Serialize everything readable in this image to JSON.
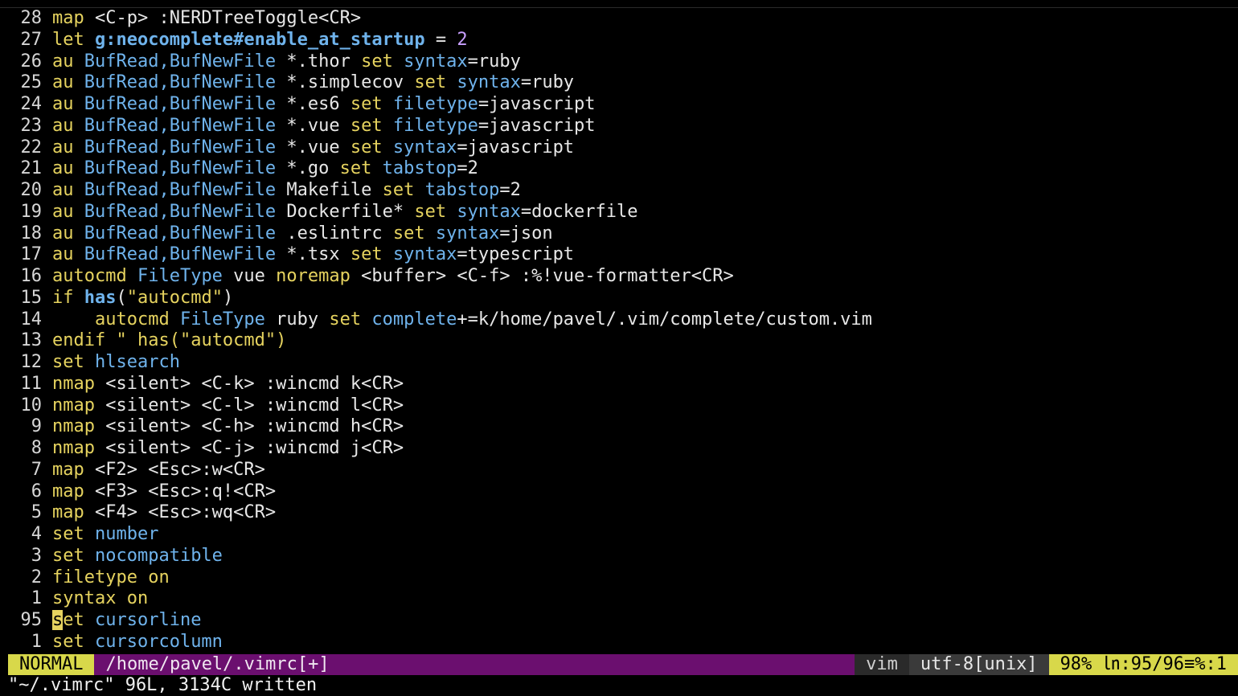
{
  "editor": {
    "lines": [
      {
        "num": "28",
        "segs": [
          [
            "map ",
            "k"
          ],
          [
            "<C-p> :NERDTreeToggle<CR>",
            "t"
          ]
        ]
      },
      {
        "num": "27",
        "segs": [
          [
            "let ",
            "k"
          ],
          [
            "g:neocomplete#enable_at_startup",
            "ob"
          ],
          [
            " = ",
            "t"
          ],
          [
            "2",
            "n"
          ]
        ]
      },
      {
        "num": "26",
        "segs": [
          [
            "au ",
            "k"
          ],
          [
            "BufRead,BufNewFile",
            "o"
          ],
          [
            " *.thor ",
            "t"
          ],
          [
            "set ",
            "k"
          ],
          [
            "syntax",
            "o"
          ],
          [
            "=ruby",
            "t"
          ]
        ]
      },
      {
        "num": "25",
        "segs": [
          [
            "au ",
            "k"
          ],
          [
            "BufRead,BufNewFile",
            "o"
          ],
          [
            " *.simplecov ",
            "t"
          ],
          [
            "set ",
            "k"
          ],
          [
            "syntax",
            "o"
          ],
          [
            "=ruby",
            "t"
          ]
        ]
      },
      {
        "num": "24",
        "segs": [
          [
            "au ",
            "k"
          ],
          [
            "BufRead,BufNewFile",
            "o"
          ],
          [
            " *.es6 ",
            "t"
          ],
          [
            "set ",
            "k"
          ],
          [
            "filetype",
            "o"
          ],
          [
            "=javascript",
            "t"
          ]
        ]
      },
      {
        "num": "23",
        "segs": [
          [
            "au ",
            "k"
          ],
          [
            "BufRead,BufNewFile",
            "o"
          ],
          [
            " *.vue ",
            "t"
          ],
          [
            "set ",
            "k"
          ],
          [
            "filetype",
            "o"
          ],
          [
            "=javascript",
            "t"
          ]
        ]
      },
      {
        "num": "22",
        "segs": [
          [
            "au ",
            "k"
          ],
          [
            "BufRead,BufNewFile",
            "o"
          ],
          [
            " *.vue ",
            "t"
          ],
          [
            "set ",
            "k"
          ],
          [
            "syntax",
            "o"
          ],
          [
            "=javascript",
            "t"
          ]
        ]
      },
      {
        "num": "21",
        "segs": [
          [
            "au ",
            "k"
          ],
          [
            "BufRead,BufNewFile",
            "o"
          ],
          [
            " *.go ",
            "t"
          ],
          [
            "set ",
            "k"
          ],
          [
            "tabstop",
            "o"
          ],
          [
            "=2",
            "t"
          ]
        ]
      },
      {
        "num": "20",
        "segs": [
          [
            "au ",
            "k"
          ],
          [
            "BufRead,BufNewFile",
            "o"
          ],
          [
            " Makefile ",
            "t"
          ],
          [
            "set ",
            "k"
          ],
          [
            "tabstop",
            "o"
          ],
          [
            "=2",
            "t"
          ]
        ]
      },
      {
        "num": "19",
        "segs": [
          [
            "au ",
            "k"
          ],
          [
            "BufRead,BufNewFile",
            "o"
          ],
          [
            " Dockerfile* ",
            "t"
          ],
          [
            "set ",
            "k"
          ],
          [
            "syntax",
            "o"
          ],
          [
            "=dockerfile",
            "t"
          ]
        ]
      },
      {
        "num": "18",
        "segs": [
          [
            "au ",
            "k"
          ],
          [
            "BufRead,BufNewFile",
            "o"
          ],
          [
            " .eslintrc ",
            "t"
          ],
          [
            "set ",
            "k"
          ],
          [
            "syntax",
            "o"
          ],
          [
            "=json",
            "t"
          ]
        ]
      },
      {
        "num": "17",
        "segs": [
          [
            "au ",
            "k"
          ],
          [
            "BufRead,BufNewFile",
            "o"
          ],
          [
            " *.tsx ",
            "t"
          ],
          [
            "set ",
            "k"
          ],
          [
            "syntax",
            "o"
          ],
          [
            "=typescript",
            "t"
          ]
        ]
      },
      {
        "num": "16",
        "segs": [
          [
            "autocmd ",
            "k"
          ],
          [
            "FileType",
            "o"
          ],
          [
            " vue ",
            "t"
          ],
          [
            "noremap ",
            "k"
          ],
          [
            "<buffer> <C-f> :%!vue-formatter<CR>",
            "t"
          ]
        ]
      },
      {
        "num": "15",
        "segs": [
          [
            "if ",
            "k"
          ],
          [
            "has",
            "ob"
          ],
          [
            "(",
            "t"
          ],
          [
            "\"autocmd\"",
            "s"
          ],
          [
            ")",
            "t"
          ]
        ]
      },
      {
        "num": "14",
        "segs": [
          [
            "    autocmd ",
            "k"
          ],
          [
            "FileType",
            "o"
          ],
          [
            " ruby ",
            "t"
          ],
          [
            "set ",
            "k"
          ],
          [
            "complete",
            "o"
          ],
          [
            "+=k/home/pavel/.vim/complete/custom.vim",
            "t"
          ]
        ]
      },
      {
        "num": "13",
        "segs": [
          [
            "endif ",
            "k"
          ],
          [
            "\" has(\"autocmd\")",
            "s"
          ]
        ]
      },
      {
        "num": "12",
        "segs": [
          [
            "set ",
            "k"
          ],
          [
            "hlsearch",
            "o"
          ]
        ]
      },
      {
        "num": "11",
        "segs": [
          [
            "nmap ",
            "k"
          ],
          [
            "<silent> <C-k> :wincmd k<CR>",
            "t"
          ]
        ]
      },
      {
        "num": "10",
        "segs": [
          [
            "nmap ",
            "k"
          ],
          [
            "<silent> <C-l> :wincmd l<CR>",
            "t"
          ]
        ]
      },
      {
        "num": "9",
        "segs": [
          [
            "nmap ",
            "k"
          ],
          [
            "<silent> <C-h> :wincmd h<CR>",
            "t"
          ]
        ]
      },
      {
        "num": "8",
        "segs": [
          [
            "nmap ",
            "k"
          ],
          [
            "<silent> <C-j> :wincmd j<CR>",
            "t"
          ]
        ]
      },
      {
        "num": "7",
        "segs": [
          [
            "map ",
            "k"
          ],
          [
            "<F2> <Esc>:w<CR>",
            "t"
          ]
        ]
      },
      {
        "num": "6",
        "segs": [
          [
            "map ",
            "k"
          ],
          [
            "<F3> <Esc>:q!<CR>",
            "t"
          ]
        ]
      },
      {
        "num": "5",
        "segs": [
          [
            "map ",
            "k"
          ],
          [
            "<F4> <Esc>:wq<CR>",
            "t"
          ]
        ]
      },
      {
        "num": "4",
        "segs": [
          [
            "set ",
            "k"
          ],
          [
            "number",
            "o"
          ]
        ]
      },
      {
        "num": "3",
        "segs": [
          [
            "set ",
            "k"
          ],
          [
            "nocompatible",
            "o"
          ]
        ]
      },
      {
        "num": "2",
        "segs": [
          [
            "filetype ",
            "k"
          ],
          [
            "on",
            "k"
          ]
        ]
      },
      {
        "num": "1",
        "segs": [
          [
            "syntax ",
            "k"
          ],
          [
            "on",
            "k"
          ]
        ]
      },
      {
        "num": "95",
        "segs": [
          [
            "s",
            "cursor"
          ],
          [
            "et ",
            "k"
          ],
          [
            "cursorline",
            "o"
          ]
        ],
        "current": true
      },
      {
        "num": "1",
        "segs": [
          [
            "set ",
            "k"
          ],
          [
            "cursorcolumn",
            "o"
          ]
        ]
      }
    ]
  },
  "statusline": {
    "mode": "NORMAL",
    "file": "/home/pavel/.vimrc[+]",
    "filetype": "vim",
    "encoding": "utf-8[unix]",
    "position": "98% ㏑:95/96≡%:1"
  },
  "cmdline": {
    "message": "\"~/.vimrc\" 96L, 3134C written"
  },
  "colors": {
    "background": "#000000",
    "keyword": "#e6d35f",
    "option": "#6fb3ec",
    "number": "#c9a0ff",
    "statusline_bg": "#6b0f6f",
    "mode_bg": "#d8d84a"
  }
}
